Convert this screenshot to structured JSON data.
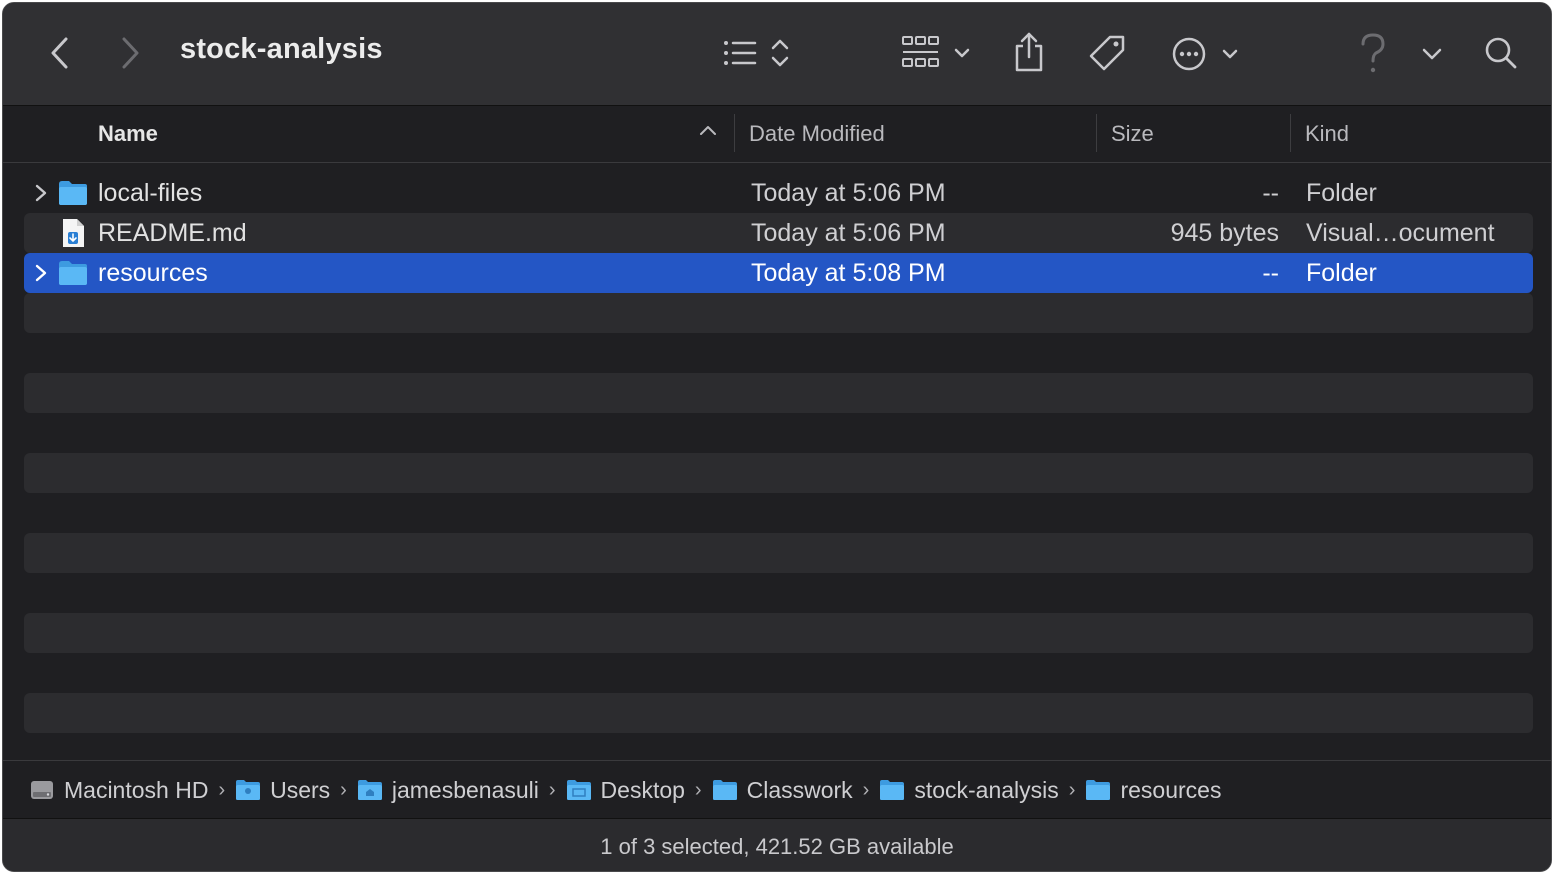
{
  "window": {
    "title": "stock-analysis"
  },
  "toolbar": {
    "back": "back-icon",
    "forward": "forward-icon",
    "view_mode": "list-view-icon",
    "group": "grid-group-icon",
    "share": "share-icon",
    "tag": "tag-icon",
    "more": "ellipsis-icon",
    "help": "question-icon",
    "search": "search-icon"
  },
  "columns": {
    "name": "Name",
    "date": "Date Modified",
    "size": "Size",
    "kind": "Kind"
  },
  "files": [
    {
      "name": "local-files",
      "date": "Today at 5:06 PM",
      "size": "--",
      "kind": "Folder",
      "type": "folder",
      "expandable": true,
      "selected": false
    },
    {
      "name": "README.md",
      "date": "Today at 5:06 PM",
      "size": "945 bytes",
      "kind": "Visual…ocument",
      "type": "document",
      "expandable": false,
      "selected": false
    },
    {
      "name": "resources",
      "date": "Today at 5:08 PM",
      "size": "--",
      "kind": "Folder",
      "type": "folder",
      "expandable": true,
      "selected": true
    }
  ],
  "path": [
    {
      "label": "Macintosh HD",
      "icon": "hard-drive-icon"
    },
    {
      "label": "Users",
      "icon": "folder-icon"
    },
    {
      "label": "jamesbenasuli",
      "icon": "home-folder-icon"
    },
    {
      "label": "Desktop",
      "icon": "desktop-folder-icon"
    },
    {
      "label": "Classwork",
      "icon": "folder-icon"
    },
    {
      "label": "stock-analysis",
      "icon": "folder-icon"
    },
    {
      "label": "resources",
      "icon": "folder-icon"
    }
  ],
  "status": {
    "text": "1 of 3 selected, 421.52 GB available"
  },
  "colors": {
    "selection": "#2456c5",
    "folder": "#5ab8f5",
    "background": "#1f1f22"
  }
}
